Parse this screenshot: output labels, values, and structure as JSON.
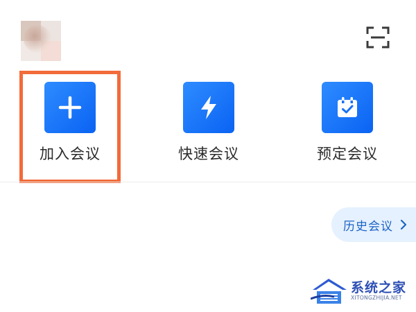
{
  "header": {
    "avatar_icon": "user-avatar",
    "scan_icon": "scan-icon"
  },
  "actions": [
    {
      "label": "加入会议",
      "icon": "plus-icon"
    },
    {
      "label": "快速会议",
      "icon": "lightning-icon"
    },
    {
      "label": "预定会议",
      "icon": "calendar-check-icon"
    }
  ],
  "history": {
    "label": "历史会议",
    "icon": "chevron-right-icon"
  },
  "watermark": {
    "title": "系统之家",
    "subtitle": "XITONGZHIJIA.NET"
  },
  "colors": {
    "accent": "#0a63f3",
    "highlight": "#f26b3a",
    "history_bg": "#e6f1ff",
    "history_text": "#1c63c6"
  }
}
